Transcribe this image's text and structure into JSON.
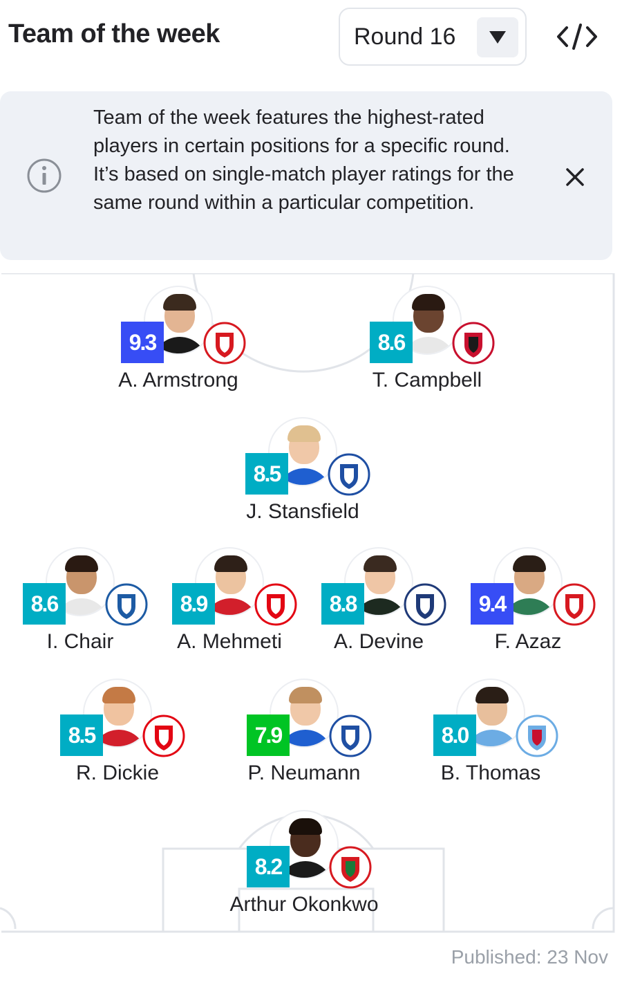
{
  "header": {
    "title": "Team of the week",
    "round_label": "Round 16"
  },
  "info": {
    "text": "Team of the week features the highest-rated players in certain positions for a specific round. It’s based on single-match player ratings for the same round within a particular competition."
  },
  "colors": {
    "rating_high": "#374df5",
    "rating_good": "#00adc4",
    "rating_ok": "#00c424"
  },
  "players": [
    {
      "name": "A. Armstrong",
      "rating": "9.3",
      "rating_color": "#374df5",
      "club_colors": [
        "#d71920",
        "#ffffff"
      ],
      "crest_icon": "southampton-crest-icon",
      "skin": "#e3b593",
      "hair": "#3b2a1e",
      "shirt": "#1a1a1a"
    },
    {
      "name": "T. Campbell",
      "rating": "8.6",
      "rating_color": "#00adc4",
      "club_colors": [
        "#c8102e",
        "#1a1a1a"
      ],
      "crest_icon": "sheffield-united-crest-icon",
      "skin": "#6b4430",
      "hair": "#2a1a12",
      "shirt": "#e8e8e8"
    },
    {
      "name": "J. Stansfield",
      "rating": "8.5",
      "rating_color": "#00adc4",
      "club_colors": [
        "#1f4fa3",
        "#ffffff"
      ],
      "crest_icon": "birmingham-crest-icon",
      "skin": "#f0c8a8",
      "hair": "#e0c090",
      "shirt": "#1f5fd0"
    },
    {
      "name": "I. Chair",
      "rating": "8.6",
      "rating_color": "#00adc4",
      "club_colors": [
        "#1d5ba4",
        "#ffffff"
      ],
      "crest_icon": "qpr-crest-icon",
      "skin": "#c9956c",
      "hair": "#2a1a12",
      "shirt": "#e8e8e8"
    },
    {
      "name": "A. Mehmeti",
      "rating": "8.9",
      "rating_color": "#00adc4",
      "club_colors": [
        "#e30613",
        "#ffffff"
      ],
      "crest_icon": "bristol-city-crest-icon",
      "skin": "#ecc3a0",
      "hair": "#2e2018",
      "shirt": "#d21f2b"
    },
    {
      "name": "A. Devine",
      "rating": "8.8",
      "rating_color": "#00adc4",
      "club_colors": [
        "#1f3a78",
        "#ffffff"
      ],
      "crest_icon": "preston-crest-icon",
      "skin": "#efc6a6",
      "hair": "#3a2a20",
      "shirt": "#1d2a20"
    },
    {
      "name": "F. Azaz",
      "rating": "9.4",
      "rating_color": "#374df5",
      "club_colors": [
        "#d71920",
        "#ffffff"
      ],
      "crest_icon": "southampton-crest-icon",
      "skin": "#d9a983",
      "hair": "#2a1e16",
      "shirt": "#2e7d55"
    },
    {
      "name": "R. Dickie",
      "rating": "8.5",
      "rating_color": "#00adc4",
      "club_colors": [
        "#e30613",
        "#ffffff"
      ],
      "crest_icon": "bristol-city-crest-icon",
      "skin": "#f0c3a0",
      "hair": "#c47a45",
      "shirt": "#d21f2b"
    },
    {
      "name": "P. Neumann",
      "rating": "7.9",
      "rating_color": "#00c424",
      "club_colors": [
        "#1f4fa3",
        "#ffffff"
      ],
      "crest_icon": "birmingham-crest-icon",
      "skin": "#f0c8a8",
      "hair": "#c09060",
      "shirt": "#1f5fd0"
    },
    {
      "name": "B. Thomas",
      "rating": "8.0",
      "rating_color": "#00adc4",
      "club_colors": [
        "#6cace4",
        "#c8102e"
      ],
      "crest_icon": "coventry-crest-icon",
      "skin": "#e8bf9c",
      "hair": "#2a1e16",
      "shirt": "#6cace4"
    },
    {
      "name": "Arthur Okonkwo",
      "rating": "8.2",
      "rating_color": "#00adc4",
      "club_colors": [
        "#d71920",
        "#1a7a3a"
      ],
      "crest_icon": "wrexham-crest-icon",
      "skin": "#4a2c1e",
      "hair": "#1a100a",
      "shirt": "#1a1a1a"
    }
  ],
  "footer": {
    "published": "Published: 23 Nov"
  }
}
